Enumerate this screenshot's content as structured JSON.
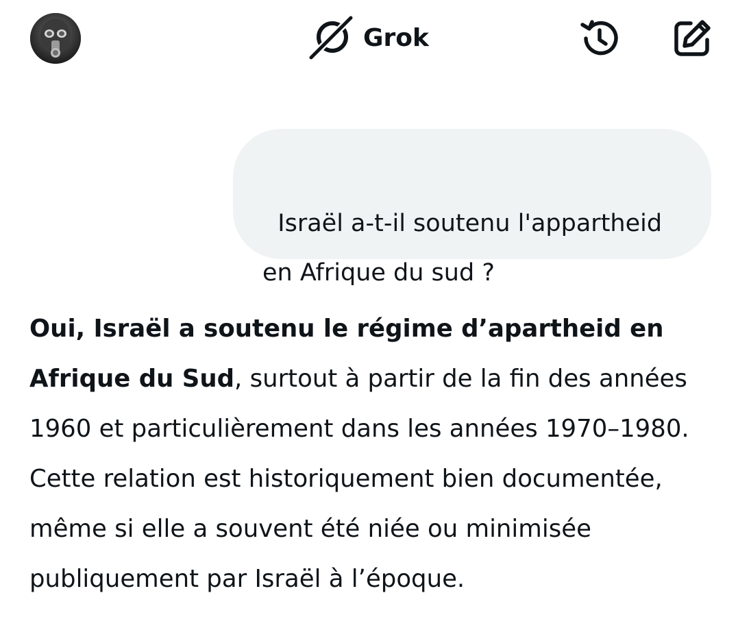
{
  "header": {
    "title": "Grok",
    "avatar_icon": "user-avatar-gas-mask",
    "brand_icon": "grok-logo-icon",
    "history_icon": "history-icon",
    "compose_icon": "new-chat-edit-icon"
  },
  "conversation": {
    "user_message": "Israël a-t-il soutenu l'appartheid en Afrique du sud ?",
    "assistant_reply": {
      "bold_lead": "Oui, Israël a soutenu le régime d’apartheid en Afrique du Sud",
      "rest": ", surtout à partir de la fin des années 1960 et particulièrement dans les années 1970–1980. Cette relation est historiquement bien documentée, même si elle a souvent été niée ou minimisée publiquement par Israël à l’époque."
    }
  },
  "colors": {
    "text": "#0f1419",
    "bubble_background": "#eff3f4",
    "background": "#ffffff"
  }
}
